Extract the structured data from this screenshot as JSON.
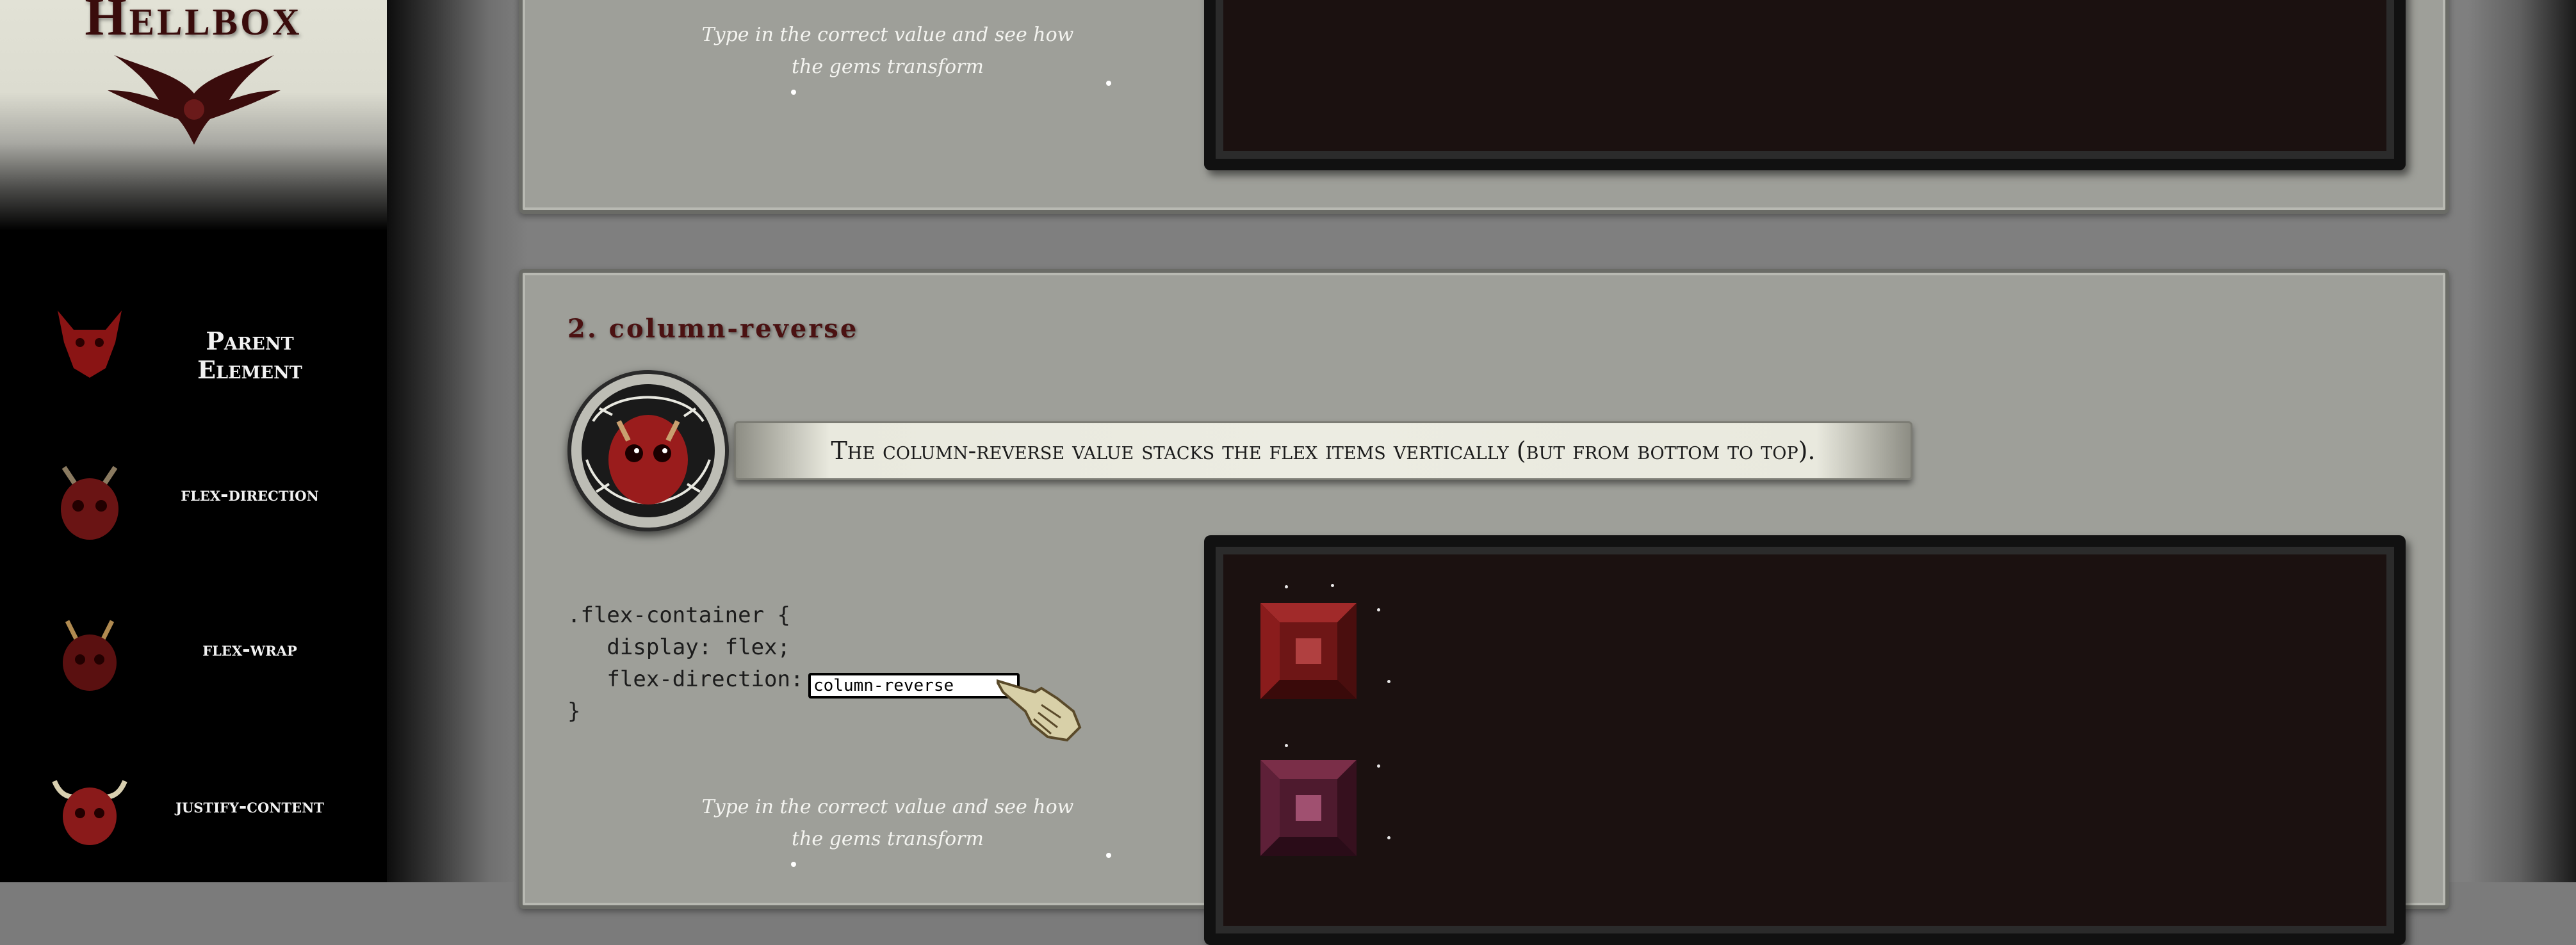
{
  "sidebar": {
    "logo": "Hellbox",
    "items": [
      {
        "label": "Parent Element"
      },
      {
        "label": "flex-direction"
      },
      {
        "label": "flex-wrap"
      },
      {
        "label": "justify-content"
      }
    ]
  },
  "top_panel": {
    "instructions": "Type in the correct value and see how the gems transform"
  },
  "main_panel": {
    "title": "2. column-reverse",
    "hint": "The column-reverse value stacks the flex items vertically (but from bottom to top).",
    "code": {
      "line1": ".flex-container {",
      "line2": "   display: flex;",
      "line3": "   flex-direction:",
      "line4": "}",
      "input_value": "column-reverse"
    },
    "instructions": "Type in the correct value and see how the gems transform"
  },
  "colors": {
    "panel": "#9e9f99",
    "demo_bg": "#1b1110",
    "gem_red": "#7a1a1a",
    "gem_plum": "#5a1e30",
    "title": "#4b1212"
  }
}
